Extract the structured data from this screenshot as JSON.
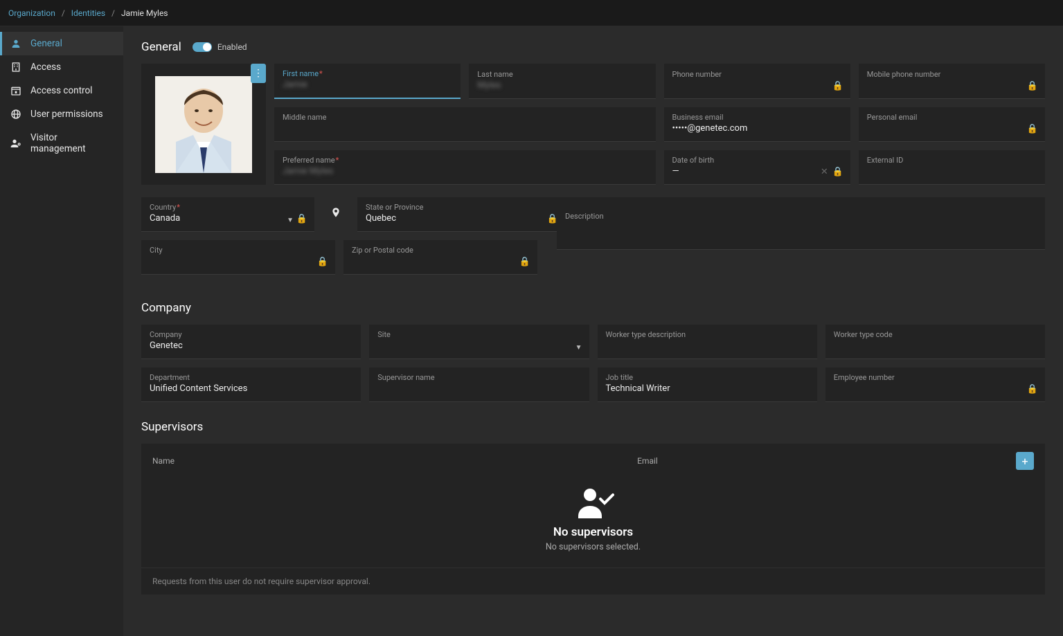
{
  "breadcrumb": {
    "org": "Organization",
    "identities": "Identities",
    "current": "Jamie Myles"
  },
  "sidebar": {
    "general": "General",
    "access": "Access",
    "accessControl": "Access control",
    "userPermissions": "User permissions",
    "visitorManagement": "Visitor management"
  },
  "sections": {
    "general": "General",
    "company": "Company",
    "supervisors": "Supervisors"
  },
  "toggle": {
    "label": "Enabled"
  },
  "fields": {
    "firstName": {
      "label": "First name",
      "value": "Jamie"
    },
    "lastName": {
      "label": "Last name",
      "value": "Myles"
    },
    "phone": {
      "label": "Phone number",
      "value": ""
    },
    "mobile": {
      "label": "Mobile phone number",
      "value": ""
    },
    "middle": {
      "label": "Middle name",
      "value": ""
    },
    "businessEmail": {
      "label": "Business email",
      "value": "•••••@genetec.com"
    },
    "personalEmail": {
      "label": "Personal email",
      "value": ""
    },
    "preferred": {
      "label": "Preferred name",
      "value": "Jamie Myles"
    },
    "dob": {
      "label": "Date of birth",
      "value": "—"
    },
    "externalId": {
      "label": "External ID",
      "value": ""
    },
    "country": {
      "label": "Country",
      "value": "Canada"
    },
    "state": {
      "label": "State or Province",
      "value": "Quebec"
    },
    "description": {
      "label": "Description",
      "value": ""
    },
    "city": {
      "label": "City",
      "value": ""
    },
    "zip": {
      "label": "Zip or Postal code",
      "value": ""
    },
    "companyName": {
      "label": "Company",
      "value": "Genetec"
    },
    "site": {
      "label": "Site",
      "value": ""
    },
    "workerTypeDesc": {
      "label": "Worker type description",
      "value": ""
    },
    "workerTypeCode": {
      "label": "Worker type code",
      "value": ""
    },
    "department": {
      "label": "Department",
      "value": "Unified Content Services"
    },
    "supervisorName": {
      "label": "Supervisor name",
      "value": ""
    },
    "jobTitle": {
      "label": "Job title",
      "value": "Technical Writer"
    },
    "employeeNumber": {
      "label": "Employee number",
      "value": ""
    }
  },
  "supervisors": {
    "nameHeader": "Name",
    "emailHeader": "Email",
    "emptyTitle": "No supervisors",
    "emptySub": "No supervisors selected.",
    "footer": "Requests from this user do not require supervisor approval."
  }
}
